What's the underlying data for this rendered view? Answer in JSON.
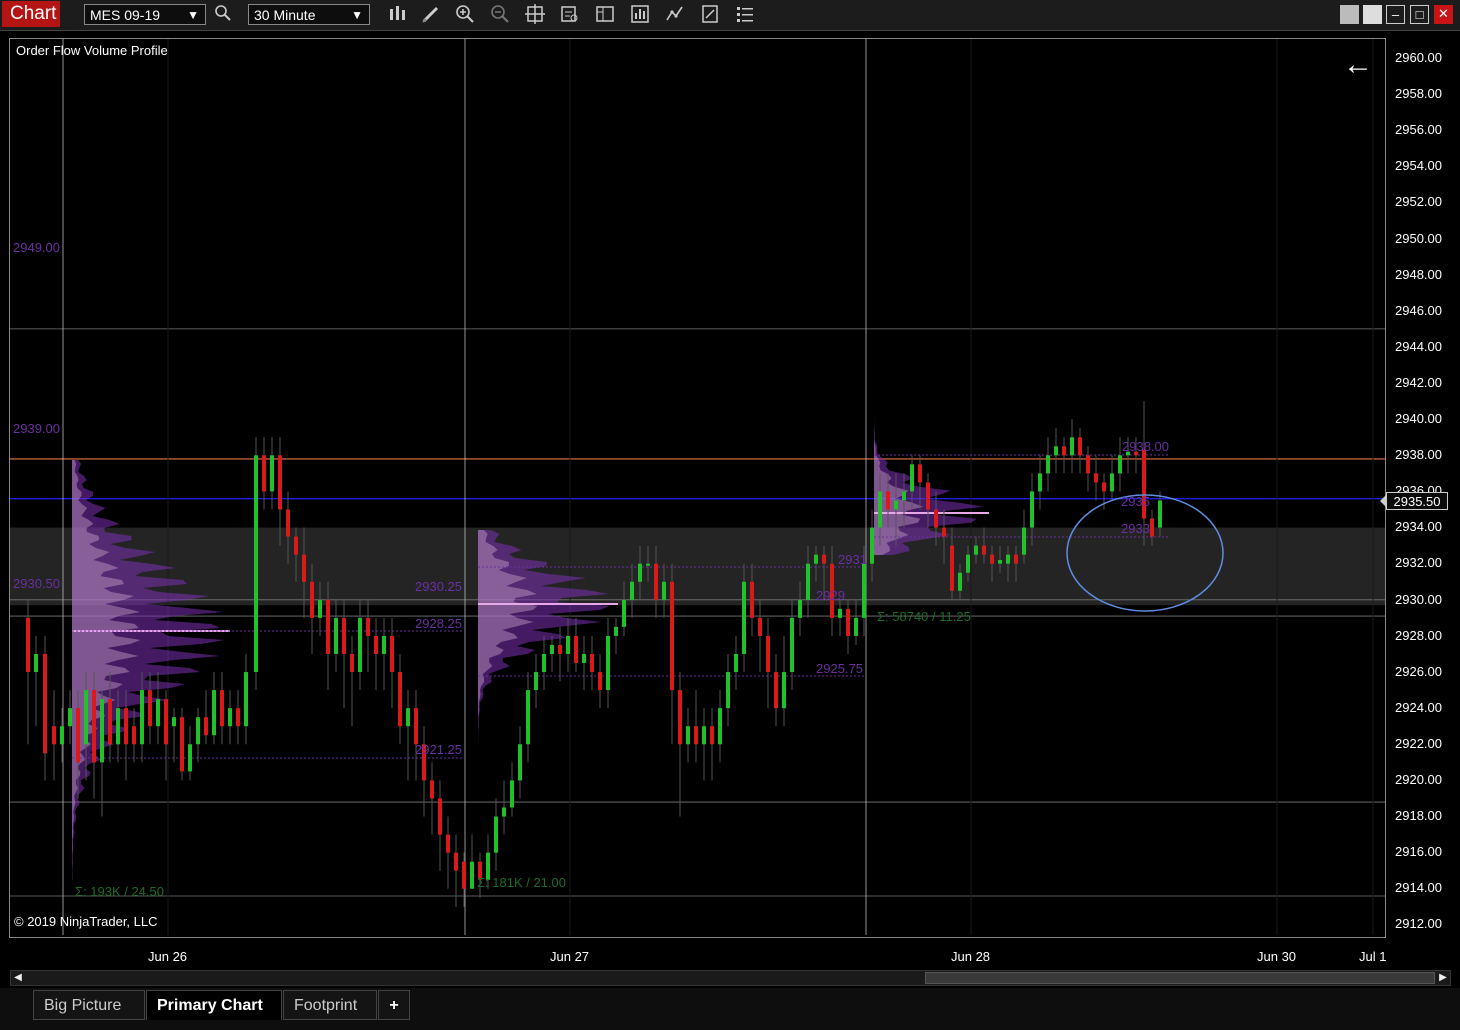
{
  "toolbar": {
    "title": "Chart",
    "instrument": "MES 09-19",
    "interval": "30 Minute",
    "icons": [
      "search-icon",
      "bars-type-icon",
      "drawing-tools-icon",
      "zoom-in-icon",
      "zoom-out-icon",
      "crosshair-icon",
      "data-box-icon",
      "strategies-icon",
      "indicators-icon",
      "chart-trader-icon",
      "properties-icon",
      "templates-icon"
    ]
  },
  "chart": {
    "indicator_label": "Order Flow Volume Profile",
    "copyright": "© 2019 NinjaTrader, LLC",
    "current_price": "2935.50",
    "price_axis": [
      "2960.00",
      "2958.00",
      "2956.00",
      "2954.00",
      "2952.00",
      "2950.00",
      "2948.00",
      "2946.00",
      "2944.00",
      "2942.00",
      "2940.00",
      "2938.00",
      "2936.00",
      "2934.00",
      "2932.00",
      "2930.00",
      "2928.00",
      "2926.00",
      "2924.00",
      "2922.00",
      "2920.00",
      "2918.00",
      "2916.00",
      "2914.00",
      "2912.00"
    ],
    "time_axis": [
      "Jun 26",
      "Jun 27",
      "Jun 28",
      "Jun 30",
      "Jul 1"
    ],
    "profile_labels": {
      "p1": "2949.00",
      "p2": "2939.00",
      "p3": "2930.50",
      "p4": "2930.25",
      "p5": "2928.25",
      "p6": "2921.25",
      "p7": "2925.75",
      "p8": "2938.00",
      "p9": "2935",
      "p10": "2933",
      "p11": "2931",
      "p12": "2929",
      "sum1": "Σ: 193K / 24.50",
      "sum2": "Σ: 181K / 21.00",
      "sum3": "Σ: 58740 / 11.25"
    },
    "colors": {
      "up": "#22c02a",
      "down": "#d81a1a",
      "profile": "#7b2fb5",
      "value_area": "#2a2a2a",
      "current_price": "#1e1ee0",
      "resistance": "#c0603a",
      "ellipse": "#5f8de0"
    }
  },
  "tabs": [
    {
      "label": "Big Picture",
      "active": false
    },
    {
      "label": "Primary Chart",
      "active": true
    },
    {
      "label": "Footprint",
      "active": false
    },
    {
      "label": "+",
      "active": false
    }
  ]
}
